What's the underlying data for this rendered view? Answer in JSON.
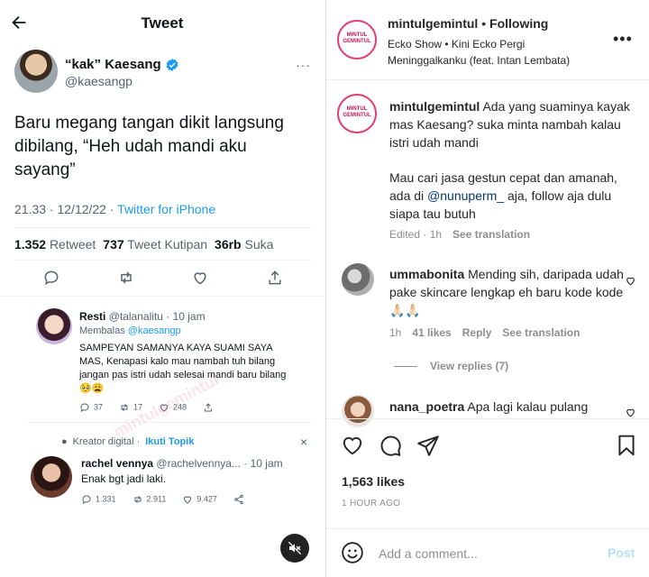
{
  "tweet": {
    "header_title": "Tweet",
    "author_name": "“kak” Kaesang",
    "author_handle": "@kaesangp",
    "more": "···",
    "text": "Baru megang tangan dikit langsung dibilang, “Heh udah mandi aku sayang”",
    "time": "21.33 · 12/12/22 · ",
    "source": "Twitter for iPhone",
    "stats": {
      "retweets_value": "1.352",
      "retweets_label": "Retweet",
      "quotes_value": "737",
      "quotes_label": "Tweet Kutipan",
      "likes_value": "36rb",
      "likes_label": "Suka"
    },
    "reply1": {
      "name": "Resti",
      "handle_time": "@talanalitu · 10 jam",
      "replying_prefix": "Membalas ",
      "replying_to": "@kaesangp",
      "text": "SAMPEYAN SAMANYA KAYA SUAMI SAYA MAS, Kenapasi kalo mau nambah tuh bilang jangan pas istri udah selesai mandi baru bilang🥺😩",
      "replies": "37",
      "retweets": "17",
      "likes": "248"
    },
    "kreator": {
      "label": "Kreator digital · ",
      "follow": "Ikuti Topik",
      "close": "×"
    },
    "reply2": {
      "name": "rachel vennya",
      "handle": "@rachelvennya...",
      "time": "· 10 jam",
      "text": "Enak bgt jadi laki.",
      "replies": "1.331",
      "retweets": "2.911",
      "likes": "9.427"
    },
    "watermark": "mintulgemintul"
  },
  "instagram": {
    "account": "mintulgemintul",
    "follow_sep": " • ",
    "follow_status": "Following",
    "logo_text": "MINTUL GEMINTUL",
    "audio": "Ecko Show • Kini Ecko Pergi Meninggalkanku (feat. Intan Lembata)",
    "more": "•••",
    "caption": {
      "username": "mintulgemintul",
      "text1": " Ada yang suaminya kayak mas Kaesang? suka minta nambah kalau istri udah mandi",
      "text2": "Mau cari jasa gestun cepat dan amanah, ada di ",
      "mention": "@nunuperm_",
      "text3": " aja, follow aja dulu siapa tau butuh",
      "meta_time": "Edited · 1h",
      "see_translation": "See translation"
    },
    "comment1": {
      "username": "ummabonita",
      "text": " Mending sih, daripada udah pake skincare lengkap eh baru kode kode 🙏🏻🙏🏻",
      "time": "1h",
      "likes": "41 likes",
      "reply": "Reply",
      "see_translation": "See translation",
      "view_replies": "View replies (7)"
    },
    "comment2": {
      "username": "nana_poetra",
      "text": " Apa lagi kalau pulang"
    },
    "likes": "1,563 likes",
    "time_ago": "1 HOUR AGO",
    "comment_placeholder": "Add a comment...",
    "post_label": "Post"
  },
  "colors": {
    "twitter_blue": "#1d9bf0",
    "instagram_link": "#00376b",
    "instagram_post_disabled": "#b2dffc",
    "secondary_text": "#8e8e8e"
  }
}
